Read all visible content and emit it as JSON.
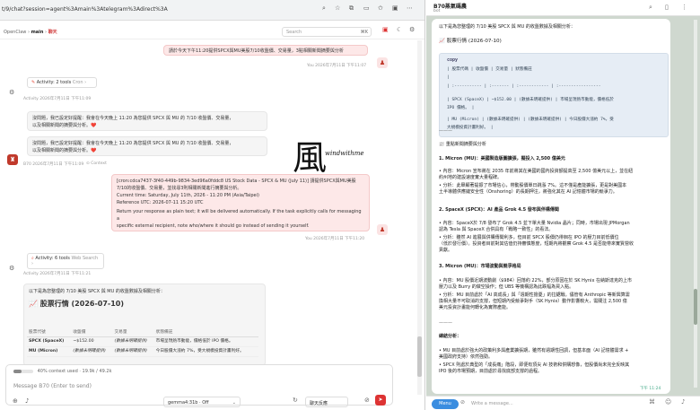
{
  "browser": {
    "url": "t/9/chat?session=agent%3Amain%3Atelegram%3Adirect%3A"
  },
  "header": {
    "app": "OpenClaw",
    "sep1": "›",
    "main": "main",
    "sep2": "›",
    "channel": "聊天",
    "search_placeholder": "Search",
    "search_kbd": "⌘K"
  },
  "messages": {
    "user1": {
      "text": "請於今天下午11:20提供SPCX與MU美股7/10收盤價、交易量，3點相關新聞摘要與分析",
      "meta": "You 2026年7月11日 下午11:07"
    },
    "activity1": {
      "title": "Activity: 2 tools",
      "sub": "Cron",
      "chev": "›"
    },
    "meta_activity1": "Activity 2026年7月11日 下午11:09",
    "a1": {
      "line1": "沒問題，我已設定好提醒：我會在今天晚上 11:20 為您提供 SPCX 與 MU 的 7/10 收盤價、交易量，",
      "line2": "以及相關新聞的摘要與分析。❤️"
    },
    "a2": {
      "line1": "沒問題，我已設定好提醒：我會在今天晚上 11:20 為您提供 SPCX 與 MU 的 7/10 收盤價、交易量，",
      "line2": "以及相關新聞的摘要與分析。❤️"
    },
    "meta_b870": "B70 2026年7月11日 下午11:09",
    "context": "Context",
    "cron": {
      "l1": "[cron:cdca7437-3f40-449b-9834-3ed96a0fddc8 US Stock Data - SPCX & MU (July 11)] 請提供SPCX與MU美股",
      "l2": "7/10的收盤價、交易量，並找尋3則相關新聞進行摘要與分析。",
      "l3": "Current time: Saturday, July 11th, 2026 - 11:20 PM (Asia/Taipei)",
      "l4": "Reference UTC: 2026-07-11 15:20 UTC",
      "l5": "Return your response as plain text; it will be delivered automatically. If the task explicitly calls for messaging a",
      "l6": "specific external recipient, note who/where it should go instead of sending it yourself.",
      "meta": "You 2026年7月11日 下午11:20"
    },
    "activity2": {
      "title": "Activity: 6 tools",
      "sub": "Web Search",
      "chev": "›"
    },
    "meta_activity2": "Activity 2026年7月11日 下午11:21",
    "report": {
      "intro": "以下是為您整理的 7/10 美股 SPCX 與 MU 的收盤數據及相關分析：",
      "heading": "📈 股票行情 (2026-07-10)"
    }
  },
  "left_table": {
    "headers": [
      "股票代號",
      "收盤價",
      "交易量",
      "狀態備註"
    ],
    "rows": [
      [
        "SPCX (SpaceX)",
        "~$152.00",
        "(數據未明確提供)",
        "市場呈現熱市動能，價格低於 IPO 價格。"
      ],
      [
        "MU (Micron)",
        "(數據未明確提供)",
        "(數據未明確提供)",
        "今日股價大漲約 7%，受大規模投資計畫利好。"
      ]
    ]
  },
  "composer": {
    "context": "40% context used",
    "tokens": "19.9k / 49.2k",
    "placeholder": "Message B70 (Enter to send)",
    "model": "gemma4:31b · Off",
    "theme": "聊天反應"
  },
  "telegram": {
    "title": "B70蒸氣碼農",
    "status": "bot",
    "intro": "以下是為您整理的 7/10 美股 SPCX 與 MU 的收盤數據及相關分析：",
    "heading": "📈 股票行情 (2026-07-10)",
    "code_lang": "copy",
    "code_rows": [
      "| 股票代碼          | 收盤價        | 交易量          | 狀態備註",
      "|",
      "| :----------- | :------- | :------------ | :-----------------",
      "| SPCX (SpaceX) | ~$152.00  | (數據未明確提供) | 市場呈現熱市動能，價格低於",
      "IPO 價格。  |",
      "| MU (Micron)   | (數據未明確提供) | (數據未明確提供) | 今日股價大漲約 7%，受",
      "大規模投資計畫利好。  |"
    ],
    "sep1": "———",
    "news_heading": "📰 重點新聞摘要與分析",
    "n1_title": "1. Micron (MU)：美國製造版圖擴張，擬投入 2,500 億美元",
    "n1_l1": "• 內容：Micron 宣布將在 2035 年前將其在美國的國內投資額提高至 2,500 億美元以上，並在紐",
    "n1_l2": "約州地的建設速度實大量程碑。",
    "n1_l3": "• 分析：此舉顯著提振了市場信心，帶動股價單日跳漲 7%。這不僅是產能擴張，更是對美國本",
    "n1_l4": "土半導體供應鏈安全性（Onshoring）的長期押注，將強化其在 AI 記憶體市場的競爭力。",
    "n2_title": "2. SpaceX (SPCX)：AI 產品 Grok 4.5 發布與伴構傳聞",
    "n2_l1": "• 內容：SpaceX於 7/8 發布了 Grok 4.5 並下單大量 Nvidia 晶片；同時，市場出現 JPMorgan",
    "n2_l2": "認為 Tesla 與 SpaceX 合併具有「戰略一致性」的看法。",
    "n2_l3": "• 分析：雖然 AI 進展與併購傳聞利多，但目前 SPCX 股價仍徘徊在 IPO 的壓力目前低價位",
    "n2_l4": "（低於發行價）。投資者目前對其估值仍持審慎態度，短期內將觀察 Grok 4.5 是否能帶來實質營收",
    "n2_l5": "貢獻。",
    "n3_title": "3. Micron (MU)：市場波動與競爭格局",
    "n3_l1": "• 內容：MU 股價近期波動劇（$984）回落約 22%，部分原因在於 SK Hynix 在納斯達克的上市",
    "n3_l2": "壓力以及 Burry 的做空操作；但 UBS 等機構認為此跌幅為買入點。",
    "n3_l3": "• 分析：MU 目前處於「AI 高成長」與「週期性擔憂」的拉鋸戰。儘管有 Anthropic 等新興算需",
    "n3_l4": "換相大量不可取消的支撐，但短期內受競爭對手（SK Hynix）動作影響較大，需關注 2,500 億",
    "n3_l5": "美元投資計畫能何轉化為實際產能。",
    "sep2": "———",
    "summary_heading": "總結分析：",
    "s1": "• MU 目前處於強大的政策利多與產業擴張期，雖然有週期性回調，但基本面（AI 記憶體需求 +",
    "s2": "美國政府支持）依然強勁。",
    "s3": "• SPCX 則處於典型的「成長痛」階段，即便有頂尖 AI 技術和併購想像，但股價尚未完全反映其",
    "s4": "IPO 後的市場預期，目前處於尋找底部支撐的過程。",
    "time": "下午 11:24",
    "menu": "Menu",
    "input_placeholder": "Write a message..."
  },
  "watermark": {
    "glyph": "風",
    "text": "windwithme"
  }
}
